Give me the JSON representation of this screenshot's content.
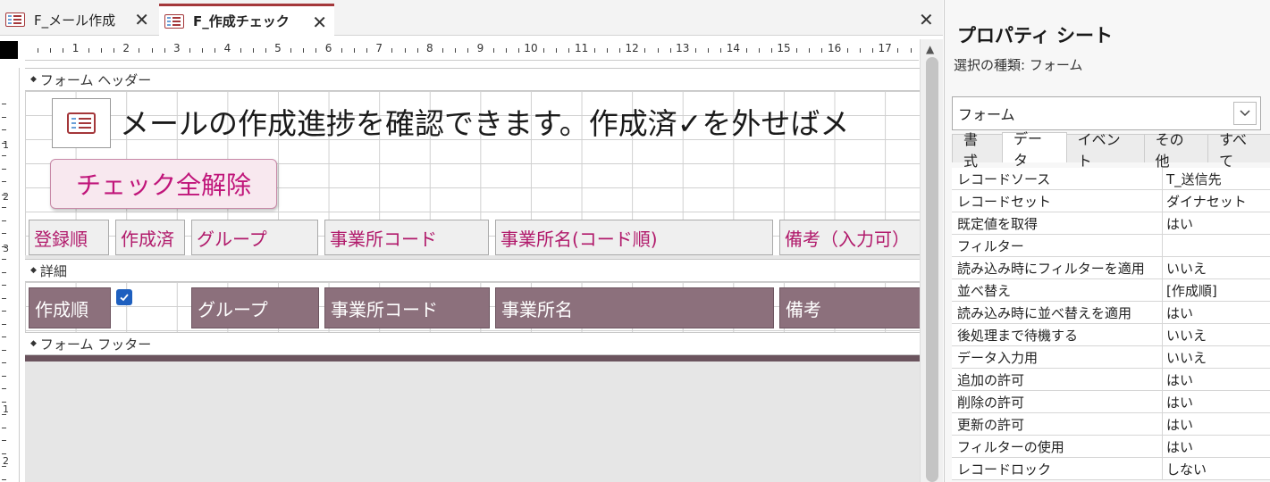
{
  "tabs": [
    {
      "label": "F_メール作成",
      "active": false
    },
    {
      "label": "F_作成チェック",
      "active": true
    }
  ],
  "close_glyph": "✕",
  "ruler": {
    "numbers": [
      "1",
      "2",
      "3",
      "4",
      "5",
      "6",
      "7",
      "8",
      "9",
      "10",
      "11",
      "12",
      "13",
      "14",
      "15",
      "16",
      "17"
    ],
    "vertical_numbers": [
      "1",
      "2",
      "3",
      "1",
      "2"
    ]
  },
  "sections": {
    "header": "フォーム ヘッダー",
    "detail": "詳細",
    "footer": "フォーム フッター"
  },
  "header": {
    "title": "メールの作成進捗を確認できます。作成済✓を外せばメ",
    "clear_button": "チェック全解除",
    "column_labels": [
      "登録順",
      "作成済",
      "グループ",
      "事業所コード",
      "事業所名(コード順)",
      "備考（入力可）"
    ]
  },
  "detail": {
    "fields": [
      "作成順",
      "グループ",
      "事業所コード",
      "事業所名",
      "備考"
    ],
    "checkbox_checked": true
  },
  "property_sheet": {
    "title": "プロパティ シート",
    "selection_type": "選択の種類:  フォーム",
    "selected_object": "フォーム",
    "tabs": [
      "書式",
      "データ",
      "イベント",
      "その他",
      "すべて"
    ],
    "active_tab": "データ",
    "properties": [
      {
        "name": "レコードソース",
        "value": "T_送信先"
      },
      {
        "name": "レコードセット",
        "value": "ダイナセット"
      },
      {
        "name": "既定値を取得",
        "value": "はい"
      },
      {
        "name": "フィルター",
        "value": ""
      },
      {
        "name": "読み込み時にフィルターを適用",
        "value": "いいえ"
      },
      {
        "name": "並べ替え",
        "value": "[作成順]"
      },
      {
        "name": "読み込み時に並べ替えを適用",
        "value": "はい"
      },
      {
        "name": "後処理まで待機する",
        "value": "いいえ"
      },
      {
        "name": "データ入力用",
        "value": "いいえ"
      },
      {
        "name": "追加の許可",
        "value": "はい"
      },
      {
        "name": "削除の許可",
        "value": "はい"
      },
      {
        "name": "更新の許可",
        "value": "はい"
      },
      {
        "name": "フィルターの使用",
        "value": "はい"
      },
      {
        "name": "レコードロック",
        "value": "しない"
      }
    ]
  },
  "colors": {
    "accent": "#a4373a",
    "button_text": "#c0157a",
    "label_text": "#b11a6b",
    "field_bg": "#8c707c"
  }
}
